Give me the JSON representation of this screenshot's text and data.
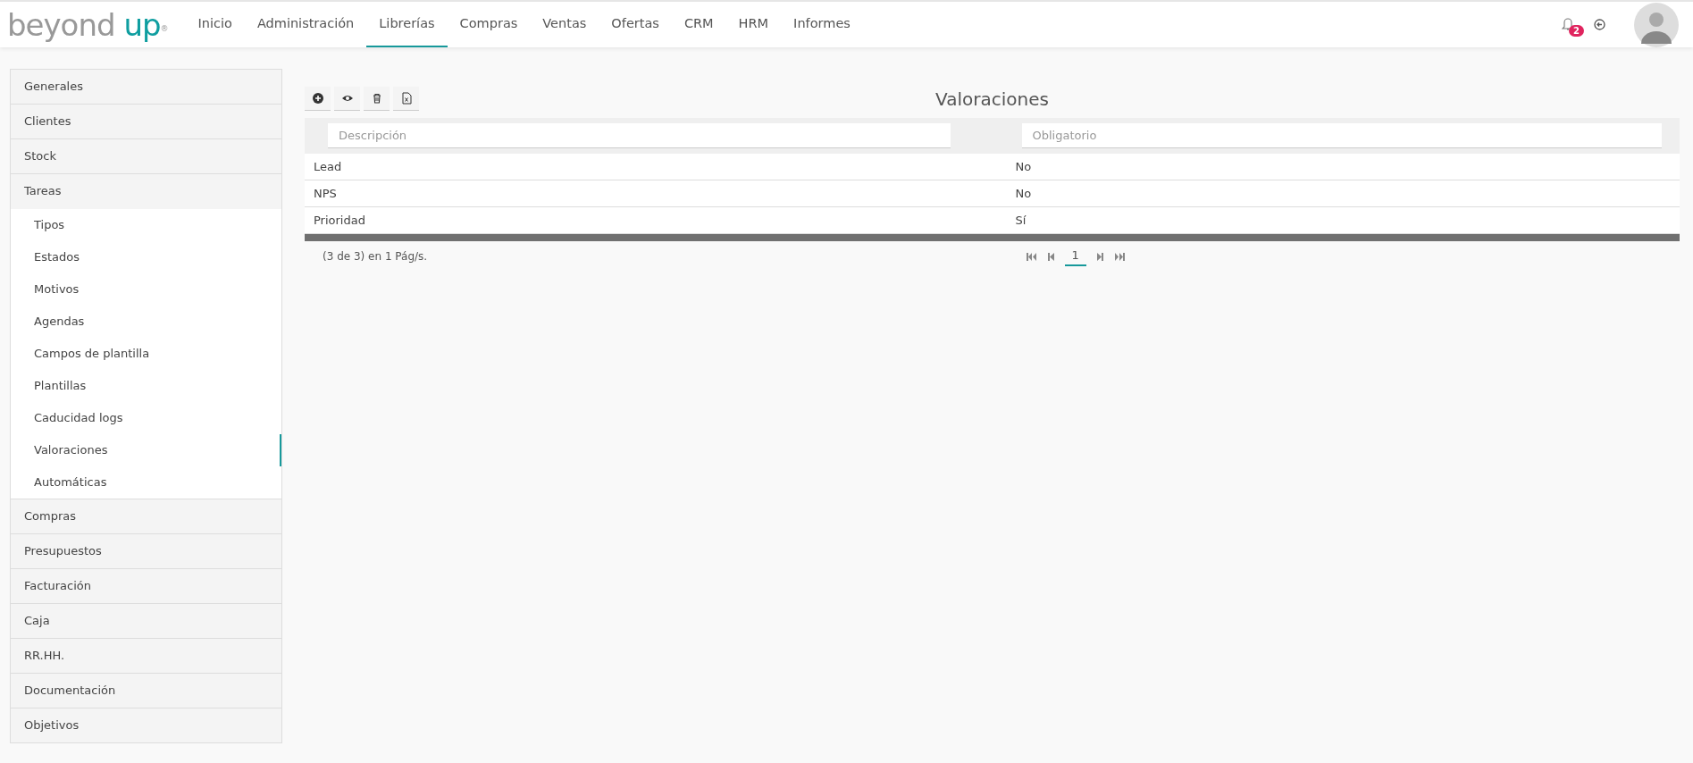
{
  "logo": {
    "word": "beyond",
    "accent": "up",
    "mark": "®"
  },
  "nav": [
    {
      "label": "Inicio",
      "selected": false
    },
    {
      "label": "Administración",
      "selected": false
    },
    {
      "label": "Librerías",
      "selected": true
    },
    {
      "label": "Compras",
      "selected": false
    },
    {
      "label": "Ventas",
      "selected": false
    },
    {
      "label": "Ofertas",
      "selected": false
    },
    {
      "label": "CRM",
      "selected": false
    },
    {
      "label": "HRM",
      "selected": false
    },
    {
      "label": "Informes",
      "selected": false
    }
  ],
  "notifications": {
    "count": "2"
  },
  "sidebar": [
    {
      "label": "Generales",
      "expanded": false
    },
    {
      "label": "Clientes",
      "expanded": false
    },
    {
      "label": "Stock",
      "expanded": false
    },
    {
      "label": "Tareas",
      "expanded": true,
      "children": [
        {
          "label": "Tipos",
          "selected": false
        },
        {
          "label": "Estados",
          "selected": false
        },
        {
          "label": "Motivos",
          "selected": false
        },
        {
          "label": "Agendas",
          "selected": false
        },
        {
          "label": "Campos de plantilla",
          "selected": false
        },
        {
          "label": "Plantillas",
          "selected": false
        },
        {
          "label": "Caducidad logs",
          "selected": false
        },
        {
          "label": "Valoraciones",
          "selected": true
        },
        {
          "label": "Automáticas",
          "selected": false
        }
      ]
    },
    {
      "label": "Compras",
      "expanded": false
    },
    {
      "label": "Presupuestos",
      "expanded": false
    },
    {
      "label": "Facturación",
      "expanded": false
    },
    {
      "label": "Caja",
      "expanded": false
    },
    {
      "label": "RR.HH.",
      "expanded": false
    },
    {
      "label": "Documentación",
      "expanded": false
    },
    {
      "label": "Objetivos",
      "expanded": false
    }
  ],
  "toolbar": [
    {
      "kind": "add"
    },
    {
      "kind": "view"
    },
    {
      "kind": "delete"
    },
    {
      "kind": "excel"
    }
  ],
  "title": "Valoraciones",
  "table": {
    "filters": [
      {
        "placeholder": "Descripción"
      },
      {
        "placeholder": "Obligatorio"
      }
    ],
    "rows": [
      [
        "Lead",
        "No"
      ],
      [
        "NPS",
        "No"
      ],
      [
        "Prioridad",
        "Sí"
      ]
    ]
  },
  "footer": {
    "summary": "(3 de 3) en 1 Pág/s.",
    "page": "1"
  }
}
